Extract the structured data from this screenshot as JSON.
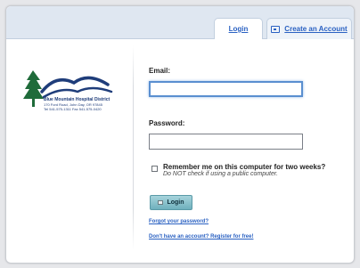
{
  "tabs": {
    "login_label": "Login",
    "create_account_label": "Create an Account"
  },
  "branding": {
    "org_name": "Blue Mountain Hospital District",
    "address_line": "170 Ford Road, John Day, OR 97845",
    "phone_line": "Tel 541-575-1311 Fax 541-575-0420"
  },
  "form": {
    "email_label": "Email:",
    "email_value": "",
    "password_label": "Password:",
    "password_value": "",
    "remember_label": "Remember me on this computer for two weeks?",
    "remember_hint": "Do NOT check if using a public computer.",
    "remember_checked": false,
    "login_button_label": "Login"
  },
  "links": {
    "forgot_password": "Forgot your password?",
    "register": "Don't have an account? Register for free!"
  },
  "colors": {
    "accent_link": "#2a61c2",
    "login_button": "#6fb0bd",
    "focus_border": "#5a8fd0",
    "logo_green": "#1f6b3a",
    "logo_blue": "#1f3d7a"
  }
}
